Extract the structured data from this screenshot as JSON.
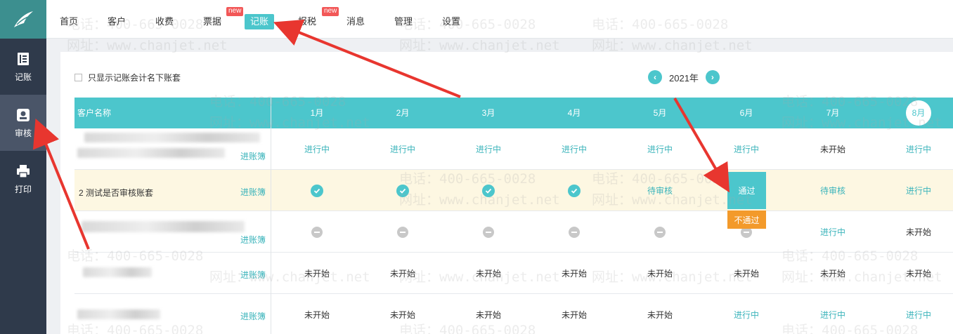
{
  "sidebar": {
    "items": [
      {
        "label": "记账",
        "icon": "ledger-icon"
      },
      {
        "label": "审核",
        "icon": "audit-stamp-icon"
      },
      {
        "label": "打印",
        "icon": "printer-icon"
      }
    ]
  },
  "topnav": {
    "tabs": [
      "首页",
      "客户",
      "收费",
      "票据",
      "记账",
      "报税",
      "消息",
      "管理",
      "设置"
    ],
    "active": "记账",
    "badge": "new"
  },
  "filter": {
    "label": "只显示记账会计名下账套"
  },
  "year": {
    "label": "2021年",
    "prev": "‹",
    "next": "›"
  },
  "table": {
    "name_header": "客户名称",
    "months": [
      "1月",
      "2月",
      "3月",
      "4月",
      "5月",
      "6月",
      "7月",
      "8月"
    ],
    "book_link": "进账簿",
    "row2_name": "2 测试是否审核账套",
    "statuses": {
      "in_progress": "进行中",
      "not_started": "未开始",
      "pending_review": "待审核"
    },
    "review_popup": {
      "pass": "通过",
      "fail": "不通过"
    }
  },
  "watermark": {
    "phone": "电话：400-665-0028",
    "site": "网址：www.chanjet.net"
  },
  "colors": {
    "accent": "#4cc6cc",
    "sidebar": "#2f3a4b",
    "warn": "#f39a2b",
    "badge": "#f25757",
    "arrow": "#e8362f"
  }
}
